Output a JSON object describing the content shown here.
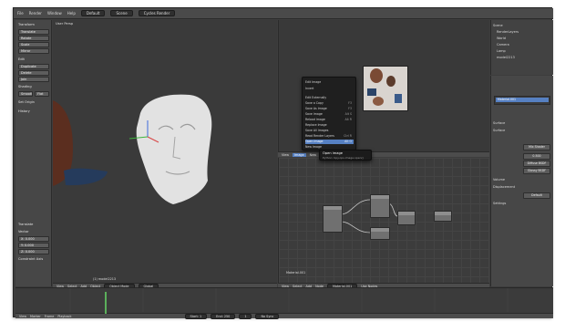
{
  "app": {
    "menu": [
      "File",
      "Render",
      "Window",
      "Help"
    ],
    "screen": "Default",
    "scene": "Scene",
    "engine": "Cycles Render"
  },
  "tool_shelf": {
    "sections": [
      {
        "label": "Transform",
        "buttons": [
          "Translate",
          "Rotate",
          "Scale",
          "Mirror"
        ]
      },
      {
        "label": "Edit",
        "buttons": [
          "Duplicate",
          "Delete",
          "Join"
        ]
      },
      {
        "label": "Shading",
        "buttons": [
          "Smooth",
          "Flat"
        ]
      },
      {
        "label": "Set Origin",
        "buttons": []
      },
      {
        "label": "History",
        "buttons": []
      }
    ],
    "redo_label": "Translate",
    "vector_label": "Vector",
    "vector_values": [
      "X: 0.000",
      "Y: 0.000",
      "Z: 0.000"
    ],
    "constraint_label": "Constraint Axis"
  },
  "viewport": {
    "label": "User Persp",
    "object_label": "(1) model2213",
    "header": [
      "View",
      "Select",
      "Add",
      "Object",
      "Object Mode",
      "Global"
    ]
  },
  "uv_editor": {
    "header": [
      "View",
      "Image",
      "New",
      "Open"
    ]
  },
  "image_menu": {
    "items": [
      {
        "label": "Edit Image",
        "key": ""
      },
      {
        "label": "Invert",
        "key": ""
      },
      {
        "label": "Edit Externally",
        "key": ""
      },
      {
        "label": "Save a Copy",
        "key": "F3"
      },
      {
        "label": "Save As Image",
        "key": "F3"
      },
      {
        "label": "Save Image",
        "key": "Alt S"
      },
      {
        "label": "Reload Image",
        "key": "Alt R"
      },
      {
        "label": "Replace Image",
        "key": ""
      },
      {
        "label": "Save All Images",
        "key": ""
      },
      {
        "label": "Read Render Layers",
        "key": "Ctrl R"
      },
      {
        "label": "Open Image",
        "key": "Alt O"
      },
      {
        "label": "New Image",
        "key": ""
      }
    ],
    "selected_index": 10,
    "tooltip_title": "Open image",
    "tooltip_body": "Python: bpy.ops.image.open()"
  },
  "node_editor": {
    "material_label": "Material.001",
    "header": [
      "View",
      "Select",
      "Add",
      "Node",
      "Material.001",
      "Use Nodes"
    ]
  },
  "outliner": {
    "items": [
      "Scene",
      "RenderLayers",
      "World",
      "Camera",
      "Lamp",
      "model2213"
    ]
  },
  "properties": {
    "material_slot": "Material.001",
    "panels": [
      "Surface",
      "Surface",
      "Volume",
      "Displacement",
      "Settings"
    ],
    "surface_shader": "Mix Shader",
    "fac": "0.500",
    "shader1": "Diffuse BSDF",
    "shader2": "Glossy BSDF",
    "displacement": "Default"
  },
  "timeline": {
    "header": [
      "View",
      "Marker",
      "Frame",
      "Playback"
    ],
    "start": "Start: 1",
    "end": "End: 250",
    "current": "1",
    "sync": "No Sync"
  },
  "colors": {
    "accent": "#5680c2",
    "background": "#3d3d3d",
    "header": "#4a4a4a"
  }
}
